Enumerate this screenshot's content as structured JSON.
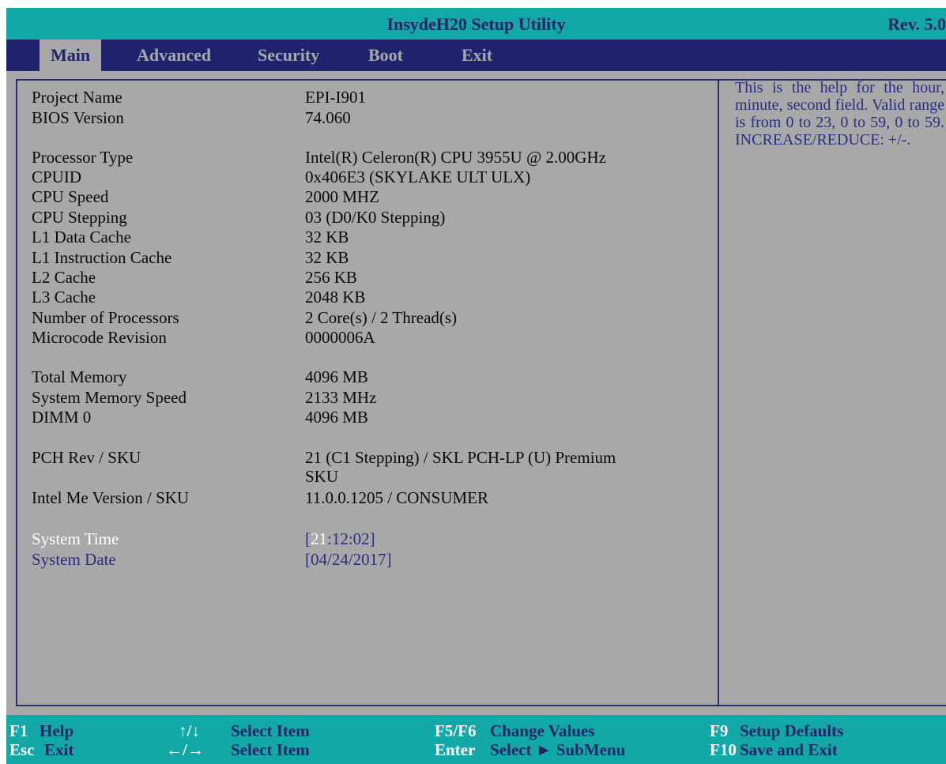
{
  "title": "InsydeH20 Setup Utility",
  "revision": "Rev. 5.0",
  "tabs": [
    {
      "label": "Main",
      "active": true
    },
    {
      "label": "Advanced"
    },
    {
      "label": "Security"
    },
    {
      "label": "Boot"
    },
    {
      "label": "Exit"
    }
  ],
  "info": {
    "project_name": {
      "label": "Project Name",
      "value": "EPI-I901"
    },
    "bios_version": {
      "label": "BIOS Version",
      "value": "74.060"
    },
    "processor_type": {
      "label": "Processor Type",
      "value": "Intel(R) Celeron(R) CPU 3955U @ 2.00GHz"
    },
    "cpuid": {
      "label": "CPUID",
      "value": "0x406E3 (SKYLAKE ULT ULX)"
    },
    "cpu_speed": {
      "label": "CPU Speed",
      "value": "2000 MHZ"
    },
    "cpu_stepping": {
      "label": "CPU Stepping",
      "value": "03 (D0/K0 Stepping)"
    },
    "l1_data": {
      "label": "L1 Data Cache",
      "value": "32 KB"
    },
    "l1_instr": {
      "label": "L1 Instruction Cache",
      "value": "32 KB"
    },
    "l2": {
      "label": "L2 Cache",
      "value": "256 KB"
    },
    "l3": {
      "label": "L3 Cache",
      "value": "2048 KB"
    },
    "num_proc": {
      "label": "Number of Processors",
      "value": "2 Core(s) / 2 Thread(s)"
    },
    "microcode": {
      "label": "Microcode Revision",
      "value": "0000006A"
    },
    "total_mem": {
      "label": "Total Memory",
      "value": "4096 MB"
    },
    "mem_speed": {
      "label": "System Memory Speed",
      "value": "2133 MHz"
    },
    "dimm0": {
      "label": "DIMM 0",
      "value": "4096 MB"
    },
    "pch": {
      "label": "PCH Rev / SKU",
      "value_line1": "21 (C1 Stepping)  / SKL PCH-LP (U) Premium",
      "value_line2": "SKU"
    },
    "me": {
      "label": "Intel Me Version / SKU",
      "value": "11.0.0.1205 / CONSUMER"
    }
  },
  "system_time": {
    "label": "System Time",
    "bracket_open": "[",
    "hour": "21",
    "rest": ":12:02]"
  },
  "system_date": {
    "label": "System Date",
    "value": "[04/24/2017]"
  },
  "help_text": "This is the help for the hour, minute, second field. Valid range is from 0 to 23, 0 to 59, 0 to 59. INCREASE/REDUCE: +/-.",
  "footer": {
    "f1_key": "F1",
    "f1_desc": "Help",
    "esc_key": "Esc",
    "esc_desc": "Exit",
    "arrows_ud": "↑/↓",
    "arrows_ud_desc": "Select Item",
    "arrows_lr": "←/→",
    "arrows_lr_desc": "Select Item",
    "f5f6_key": "F5/F6",
    "f5f6_desc": "Change Values",
    "enter_key": "Enter",
    "enter_desc": "Select ► SubMenu",
    "f9_key": "F9",
    "f9_desc": "Setup Defaults",
    "f10_key": "F10",
    "f10_desc": "Save and Exit"
  }
}
